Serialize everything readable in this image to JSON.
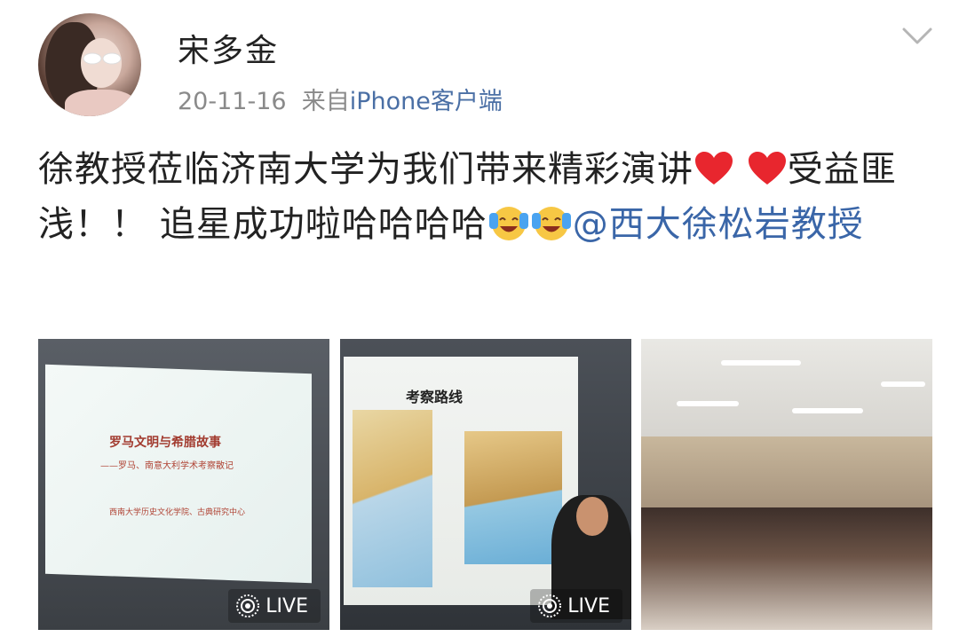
{
  "post": {
    "username": "宋多金",
    "date": "20-11-16",
    "source_prefix": "来自",
    "source": "iPhone客户端",
    "text_part1": "徐教授莅临济南大学为我们带来精彩演讲",
    "text_part2": "受益匪浅！！ 追星成功啦哈哈哈哈",
    "mention": "@西大徐松岩教授"
  },
  "photos": [
    {
      "slide_title": "罗马文明与希腊故事",
      "slide_subtitle": "——罗马、南意大利学术考察散记",
      "slide_org": "西南大学历史文化学院、古典研究中心",
      "live_label": "LIVE"
    },
    {
      "map_title": "考察路线",
      "live_label": "LIVE"
    },
    {}
  ],
  "icons": {
    "expand": "chevron-down-icon",
    "heart": "heart-icon",
    "laugh": "laughing-face-icon",
    "live": "live-photo-icon"
  },
  "colors": {
    "link": "#3a66a8",
    "meta": "#8a8a8a",
    "text": "#222222"
  }
}
